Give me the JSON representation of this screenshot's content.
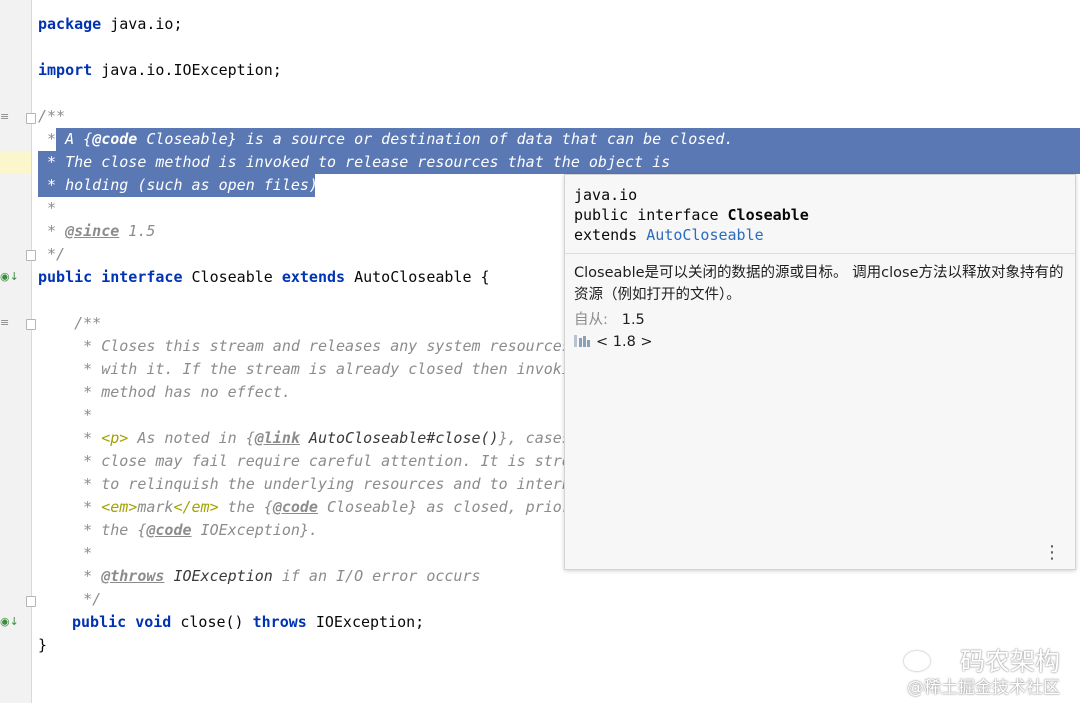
{
  "code": {
    "package_line": {
      "kw": "package",
      "rest": " java.io;"
    },
    "import_line": {
      "kw": "import",
      "rest": " java.io.IOException;"
    },
    "doc_open": "/**",
    "sel1": {
      "star": " * ",
      "pre": "A {",
      "tag": "@code",
      "post": " Closeable} is a source or destination of data that can be closed."
    },
    "sel2": " * The close method is invoked to release resources that the object is",
    "sel3": " * holding (such as open files).",
    "star_line": " *",
    "since": {
      "star": " * ",
      "tag": "@since",
      "val": " 1.5"
    },
    "doc_close": " */",
    "iface": {
      "kw1": "public",
      "kw2": "interface",
      "name": " Closeable ",
      "kw3": "extends",
      "rest": " AutoCloseable {"
    },
    "m_open": "    /**",
    "m1": "     * Closes this stream and releases any system resources a",
    "m2": "     * with it. If the stream is already closed then invoking",
    "m3": "     * method has no effect.",
    "m4": "     *",
    "m5": {
      "a": "     * ",
      "html": "<p>",
      "b": " As noted in {",
      "tag": "@link",
      "ref": " AutoCloseable#close()",
      "c": "}, cases w"
    },
    "m6": "     * close may fail require careful attention. It is strong",
    "m7": "     * to relinquish the underlying resources and to internal",
    "m8": {
      "a": "     * ",
      "h1": "<em>",
      "b": "mark",
      "h2": "</em>",
      "c": " the {",
      "tag": "@code",
      "d": " Closeable} as closed, prior t"
    },
    "m9": {
      "a": "     * the {",
      "tag": "@code",
      "b": " IOException}."
    },
    "m10": "     *",
    "m11": {
      "a": "     * ",
      "tag": "@throws",
      "ref": " IOException",
      "b": " if an I/O error occurs"
    },
    "m_close": "     */",
    "method": {
      "kw1": "public",
      "kw2": "void",
      "mid": " close() ",
      "kw3": "throws",
      "rest": " IOException;"
    },
    "end": "}"
  },
  "popup": {
    "pkg": "java.io",
    "sig_pre": "public interface ",
    "sig_name": "Closeable",
    "ext_pre": "extends ",
    "ext_link": "AutoCloseable",
    "desc": "Closeable是可以关闭的数据的源或目标。 调用close方法以释放对象持有的资源（例如打开的文件）。",
    "since_label": "自从:",
    "since_val": "1.5",
    "jdk": "< 1.8 >",
    "more_icon": "more-vertical-icon"
  },
  "watermark": {
    "line1": "码农架构",
    "line2": "@稀土掘金技术社区"
  },
  "colors": {
    "selection": "#5a78b3",
    "keyword": "#0033b3",
    "comment": "#8c8c8c",
    "link": "#2a6bc2"
  }
}
